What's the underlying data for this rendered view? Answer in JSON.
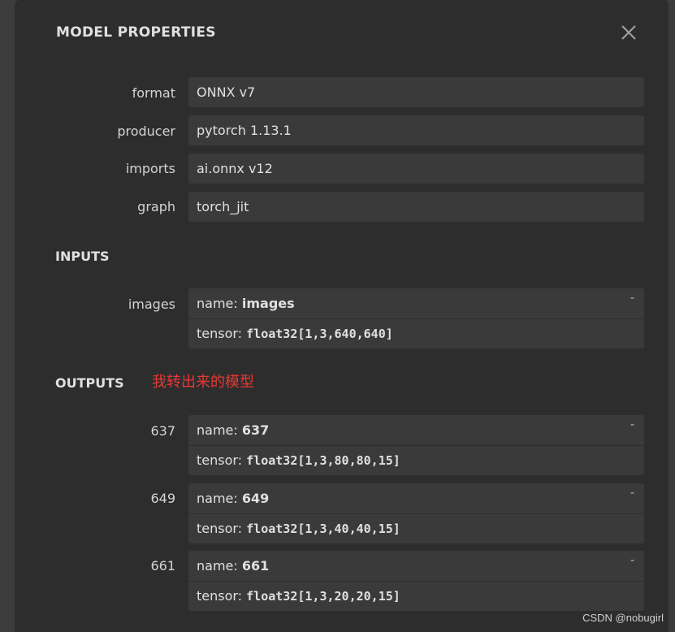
{
  "panel": {
    "title": "MODEL PROPERTIES"
  },
  "properties": [
    {
      "label": "format",
      "value": "ONNX v7"
    },
    {
      "label": "producer",
      "value": "pytorch 1.13.1"
    },
    {
      "label": "imports",
      "value": "ai.onnx v12"
    },
    {
      "label": "graph",
      "value": "torch_jit"
    }
  ],
  "inputs": {
    "title": "INPUTS",
    "items": [
      {
        "label": "images",
        "name_prefix": "name: ",
        "name": "images",
        "tensor_prefix": "tensor: ",
        "tensor": "float32[1,3,640,640]",
        "expand": "-"
      }
    ]
  },
  "outputs": {
    "title": "OUTPUTS",
    "annotation": "我转出来的模型",
    "items": [
      {
        "label": "637",
        "name_prefix": "name: ",
        "name": "637",
        "tensor_prefix": "tensor: ",
        "tensor": "float32[1,3,80,80,15]",
        "expand": "-"
      },
      {
        "label": "649",
        "name_prefix": "name: ",
        "name": "649",
        "tensor_prefix": "tensor: ",
        "tensor": "float32[1,3,40,40,15]",
        "expand": "-"
      },
      {
        "label": "661",
        "name_prefix": "name: ",
        "name": "661",
        "tensor_prefix": "tensor: ",
        "tensor": "float32[1,3,20,20,15]",
        "expand": "-"
      }
    ]
  },
  "watermark": "CSDN @nobugirl",
  "icons": {
    "close": "close-icon",
    "scroll_up": "scroll-up-arrow-icon"
  }
}
